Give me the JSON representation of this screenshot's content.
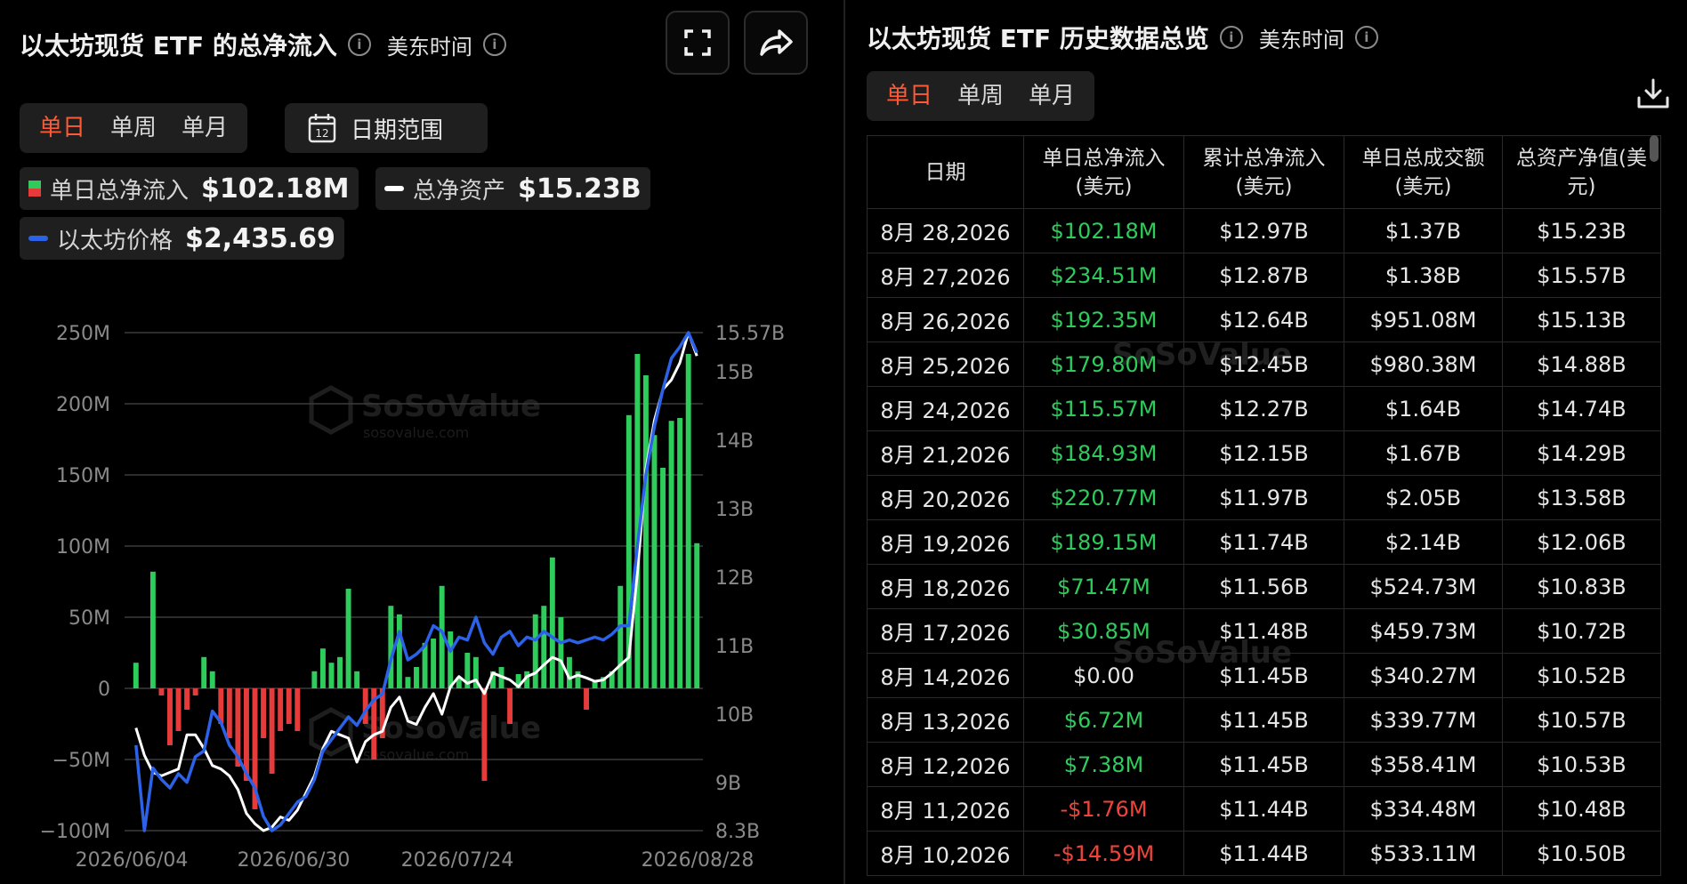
{
  "left": {
    "title": "以太坊现货 ETF 的总净流入",
    "timezone": "美东时间",
    "info_icon": "info-icon",
    "tabs": [
      {
        "label": "单日",
        "active": true
      },
      {
        "label": "单周",
        "active": false
      },
      {
        "label": "单月",
        "active": false
      }
    ],
    "date_range_label": "日期范围",
    "calendar_icon_text": "12",
    "legend": {
      "inflow_label": "单日总净流入",
      "inflow_value": "$102.18M",
      "assets_label": "总净资产",
      "assets_value": "$15.23B",
      "price_label": "以太坊价格",
      "price_value": "$2,435.69"
    },
    "watermark": "SoSoValue",
    "watermark_sub": "sosovalue.com"
  },
  "colors": {
    "positive": "#2ecc5b",
    "negative": "#e53b3b",
    "assets_line": "#ffffff",
    "price_line": "#2c62e8",
    "active_tab": "#ff5a36"
  },
  "chart_data": {
    "type": "bar",
    "left_axis": {
      "ticks": [
        "250M",
        "200M",
        "150M",
        "100M",
        "50M",
        "0",
        "−50M",
        "−100M"
      ],
      "ylim": [
        -100,
        250
      ],
      "unit": "M"
    },
    "right_axis": {
      "ticks": [
        "15.57B",
        "15B",
        "14B",
        "13B",
        "12B",
        "11B",
        "10B",
        "9B",
        "8.3B"
      ],
      "ylim": [
        8.3,
        15.57
      ],
      "unit": "B"
    },
    "x_tick_labels": [
      "2026/06/04",
      "2026/06/30",
      "2026/07/24",
      "2026/08/28"
    ],
    "series": [
      {
        "name": "单日总净流入",
        "kind": "bar",
        "values": [
          18,
          0,
          82,
          -5,
          -40,
          -30,
          -15,
          -5,
          22,
          12,
          -25,
          -35,
          -55,
          -65,
          -85,
          -35,
          -60,
          -30,
          -25,
          -30,
          0,
          12,
          28,
          18,
          22,
          70,
          12,
          -25,
          -50,
          -35,
          58,
          52,
          8,
          15,
          32,
          35,
          72,
          40,
          8,
          25,
          22,
          -65,
          12,
          15,
          -25,
          10,
          12,
          52,
          58,
          92,
          50,
          22,
          12,
          -15,
          5,
          8,
          12,
          72,
          192,
          235,
          220,
          178,
          155,
          188,
          190,
          235,
          102
        ]
      },
      {
        "name": "总净资产",
        "kind": "line",
        "values": [
          9.8,
          9.4,
          9.15,
          9.1,
          9.15,
          9.2,
          9.7,
          9.7,
          9.5,
          9.25,
          9.2,
          9.1,
          8.9,
          8.55,
          8.4,
          8.3,
          8.35,
          8.5,
          8.45,
          8.6,
          8.85,
          9.1,
          9.5,
          9.75,
          9.7,
          9.65,
          9.3,
          9.6,
          9.7,
          9.75,
          10.1,
          10.25,
          9.9,
          9.85,
          10.1,
          10.3,
          10.0,
          10.4,
          10.55,
          10.45,
          10.5,
          10.3,
          10.6,
          10.55,
          10.5,
          10.4,
          10.55,
          10.6,
          10.72,
          10.83,
          10.78,
          10.52,
          10.57,
          10.53,
          10.48,
          10.5,
          10.6,
          10.72,
          10.83,
          12.06,
          13.58,
          14.29,
          14.74,
          14.88,
          15.13,
          15.57,
          15.23
        ]
      },
      {
        "name": "以太坊价格",
        "kind": "line",
        "values": [
          0.6,
          0.3,
          0.52,
          0.48,
          0.45,
          0.5,
          0.47,
          0.56,
          0.58,
          0.72,
          0.68,
          0.6,
          0.56,
          0.5,
          0.45,
          0.35,
          0.3,
          0.32,
          0.36,
          0.4,
          0.42,
          0.48,
          0.58,
          0.62,
          0.66,
          0.7,
          0.67,
          0.72,
          0.76,
          0.78,
          0.9,
          1.0,
          0.9,
          0.92,
          0.95,
          1.02,
          1.0,
          0.93,
          0.98,
          0.97,
          1.05,
          0.96,
          0.92,
          0.98,
          1.0,
          0.95,
          0.98,
          0.97,
          1.0,
          0.98,
          0.96,
          0.97,
          0.96,
          0.97,
          0.98,
          0.97,
          0.99,
          1.02,
          1.02,
          1.3,
          1.55,
          1.72,
          1.85,
          1.96,
          2.0,
          2.05,
          1.98
        ]
      }
    ]
  },
  "right": {
    "title": "以太坊现货 ETF 历史数据总览",
    "timezone": "美东时间",
    "tabs": [
      {
        "label": "单日",
        "active": true
      },
      {
        "label": "单周",
        "active": false
      },
      {
        "label": "单月",
        "active": false
      }
    ],
    "download_icon": "download-icon",
    "watermark": "SoSoValue",
    "columns": [
      "日期",
      "单日总净流入\n(美元)",
      "累计总净流入\n(美元)",
      "单日总成交额\n(美元)",
      "总资产净值(美\n元)"
    ],
    "rows": [
      {
        "date": "8月 28,2026",
        "inflow": "$102.18M",
        "sign": "pos",
        "cum": "$12.97B",
        "volume": "$1.37B",
        "nav": "$15.23B"
      },
      {
        "date": "8月 27,2026",
        "inflow": "$234.51M",
        "sign": "pos",
        "cum": "$12.87B",
        "volume": "$1.38B",
        "nav": "$15.57B"
      },
      {
        "date": "8月 26,2026",
        "inflow": "$192.35M",
        "sign": "pos",
        "cum": "$12.64B",
        "volume": "$951.08M",
        "nav": "$15.13B"
      },
      {
        "date": "8月 25,2026",
        "inflow": "$179.80M",
        "sign": "pos",
        "cum": "$12.45B",
        "volume": "$980.38M",
        "nav": "$14.88B"
      },
      {
        "date": "8月 24,2026",
        "inflow": "$115.57M",
        "sign": "pos",
        "cum": "$12.27B",
        "volume": "$1.64B",
        "nav": "$14.74B"
      },
      {
        "date": "8月 21,2026",
        "inflow": "$184.93M",
        "sign": "pos",
        "cum": "$12.15B",
        "volume": "$1.67B",
        "nav": "$14.29B"
      },
      {
        "date": "8月 20,2026",
        "inflow": "$220.77M",
        "sign": "pos",
        "cum": "$11.97B",
        "volume": "$2.05B",
        "nav": "$13.58B"
      },
      {
        "date": "8月 19,2026",
        "inflow": "$189.15M",
        "sign": "pos",
        "cum": "$11.74B",
        "volume": "$2.14B",
        "nav": "$12.06B"
      },
      {
        "date": "8月 18,2026",
        "inflow": "$71.47M",
        "sign": "pos",
        "cum": "$11.56B",
        "volume": "$524.73M",
        "nav": "$10.83B"
      },
      {
        "date": "8月 17,2026",
        "inflow": "$30.85M",
        "sign": "pos",
        "cum": "$11.48B",
        "volume": "$459.73M",
        "nav": "$10.72B"
      },
      {
        "date": "8月 14,2026",
        "inflow": "$0.00",
        "sign": "zero",
        "cum": "$11.45B",
        "volume": "$340.27M",
        "nav": "$10.52B"
      },
      {
        "date": "8月 13,2026",
        "inflow": "$6.72M",
        "sign": "pos",
        "cum": "$11.45B",
        "volume": "$339.77M",
        "nav": "$10.57B"
      },
      {
        "date": "8月 12,2026",
        "inflow": "$7.38M",
        "sign": "pos",
        "cum": "$11.45B",
        "volume": "$358.41M",
        "nav": "$10.53B"
      },
      {
        "date": "8月 11,2026",
        "inflow": "-$1.76M",
        "sign": "neg",
        "cum": "$11.44B",
        "volume": "$334.48M",
        "nav": "$10.48B"
      },
      {
        "date": "8月 10,2026",
        "inflow": "-$14.59M",
        "sign": "neg",
        "cum": "$11.44B",
        "volume": "$533.11M",
        "nav": "$10.50B"
      }
    ]
  }
}
